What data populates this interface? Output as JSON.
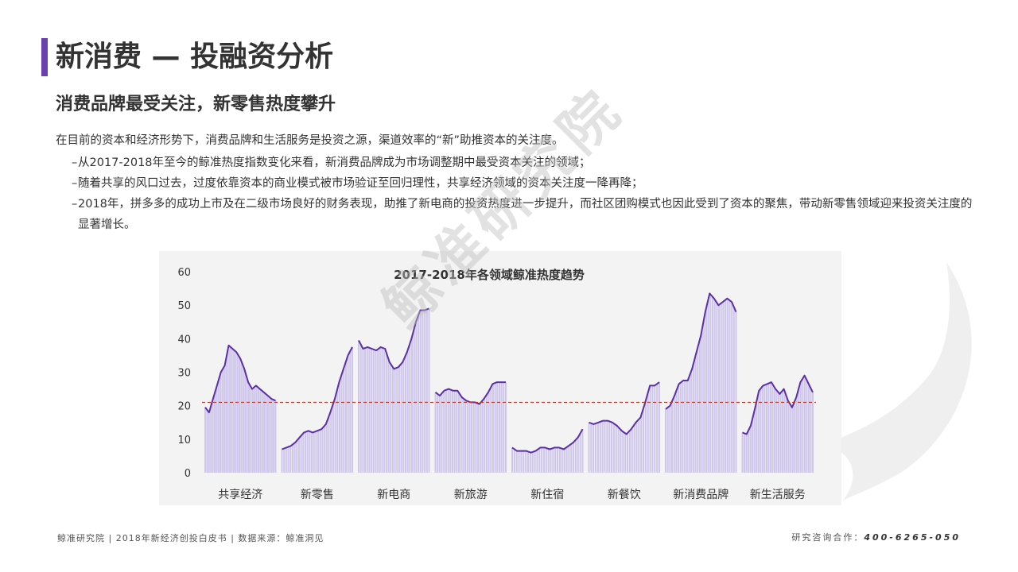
{
  "page": {
    "title": "新消费 — 投融资分析",
    "subtitle": "消费品牌最受关注，新零售热度攀升",
    "intro": "在目前的资本和经济形势下，消费品牌和生活服务是投资之源，渠道效率的“新”助推资本的关注度。",
    "bullets": [
      "从2017-2018年至今的鲸准热度指数变化来看，新消费品牌成为市场调整期中最受资本关注的领域；",
      "随着共享的风口过去，过度依靠资本的商业模式被市场验证至回归理性，共享经济领域的资本关注度一降再降；",
      "2018年，拼多多的成功上市及在二级市场良好的财务表现，助推了新电商的投资热度进一步提升，而社区团购模式也因此受到了资本的聚焦，带动新零售领域迎来投资关注度的显著增长。"
    ],
    "watermark": "鲸准研究院",
    "footer_left": "鲸准研究院 | 2018年新经济创投白皮书 | 数据来源：鲸准洞见",
    "footer_right_label": "研究咨询合作：",
    "footer_right_phone": "400-6265-050",
    "colors": {
      "accent": "#6a3fb0",
      "line": "#5b2fa8",
      "bar": "#cfc6ec",
      "reference": "#c0392b",
      "panel": "#f3f3f3"
    }
  },
  "chart_data": {
    "type": "line",
    "title": "2017-2018年各领域鲸准热度趋势",
    "xlabel": "",
    "ylabel": "",
    "ylim": [
      0,
      60
    ],
    "yticks": [
      0,
      10,
      20,
      30,
      40,
      50,
      60
    ],
    "grid": false,
    "reference_line": 21,
    "categories": [
      "共享经济",
      "新零售",
      "新电商",
      "新旅游",
      "新住宿",
      "新餐饮",
      "新消费品牌",
      "新生活服务"
    ],
    "series": [
      {
        "category": "共享经济",
        "values": [
          19.5,
          18,
          22,
          26,
          30,
          32,
          38,
          37,
          36,
          34,
          31,
          27,
          25,
          26,
          25,
          24,
          23,
          22,
          21.5
        ]
      },
      {
        "category": "新零售",
        "values": [
          7,
          7.5,
          8,
          9,
          10.5,
          12,
          12.5,
          12,
          12.5,
          13,
          14.5,
          18,
          22,
          27,
          31,
          35,
          37.5
        ]
      },
      {
        "category": "新电商",
        "values": [
          39.5,
          37,
          37.5,
          37,
          36.5,
          37.5,
          37,
          33,
          31,
          31.5,
          33,
          36,
          40,
          45,
          48.5,
          48.5,
          49
        ]
      },
      {
        "category": "新旅游",
        "values": [
          24,
          23,
          24.5,
          25,
          24.5,
          24.5,
          22.5,
          21.5,
          21,
          21,
          20.5,
          22,
          24,
          26.5,
          27,
          27,
          27
        ]
      },
      {
        "category": "新住宿",
        "values": [
          7.5,
          6.5,
          6.5,
          6.5,
          6,
          6.5,
          7.5,
          7.5,
          7,
          7.5,
          7.5,
          7,
          8,
          9,
          10.5,
          13
        ]
      },
      {
        "category": "新餐饮",
        "values": [
          15,
          14.5,
          15,
          15.5,
          15.5,
          15,
          14,
          12.5,
          11.5,
          13,
          15,
          16.5,
          21,
          26,
          26,
          27
        ]
      },
      {
        "category": "新消费品牌",
        "values": [
          19,
          20,
          23,
          26.5,
          27.5,
          27.5,
          31,
          36,
          41,
          48,
          53.5,
          52,
          50,
          51,
          52,
          51,
          48
        ]
      },
      {
        "category": "新生活服务",
        "values": [
          12,
          11.5,
          14,
          19,
          24.5,
          26,
          26.5,
          27,
          25,
          23.5,
          25,
          21.5,
          19.5,
          22.5,
          27,
          29,
          26.5,
          24
        ]
      }
    ]
  }
}
